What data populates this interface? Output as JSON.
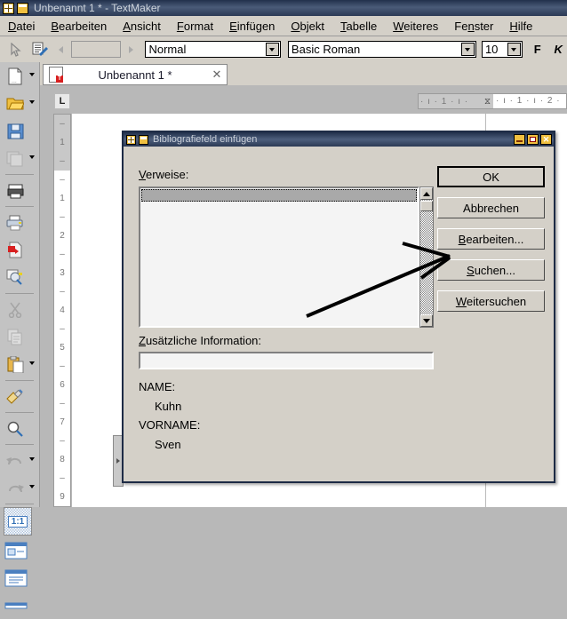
{
  "window": {
    "title": "Unbenannt 1 * - TextMaker",
    "icons": [
      "app-grid-icon",
      "document-icon"
    ]
  },
  "menubar": {
    "items": [
      {
        "label": "Datei",
        "accel": "D"
      },
      {
        "label": "Bearbeiten",
        "accel": "B"
      },
      {
        "label": "Ansicht",
        "accel": "A"
      },
      {
        "label": "Format",
        "accel": "F"
      },
      {
        "label": "Einfügen",
        "accel": "E"
      },
      {
        "label": "Objekt",
        "accel": "O"
      },
      {
        "label": "Tabelle",
        "accel": "T"
      },
      {
        "label": "Weiteres",
        "accel": "W"
      },
      {
        "label": "Fenster",
        "accel": "n"
      },
      {
        "label": "Hilfe",
        "accel": "H"
      }
    ]
  },
  "toolbar": {
    "page_field_value": "",
    "paragraph_style": "Normal",
    "font_name": "Basic Roman",
    "font_size": "10",
    "bold_label": "F",
    "italic_label": "K"
  },
  "tab": {
    "label": "Unbenannt 1 *",
    "close_label": "✕"
  },
  "rulers": {
    "tab_stop_marker": "L",
    "horizontal_ticks": "·  ı  ·  1  ·  ı  ·",
    "horizontal_ticks_page": "·  ı  ·  1  ·  ı  ·  2  ·",
    "vertical_labels": [
      "–",
      "1",
      "–",
      "–",
      "1",
      "–",
      "2",
      "–",
      "3",
      "–",
      "4",
      "–",
      "5",
      "–",
      "6",
      "–",
      "7",
      "–",
      "8",
      "–",
      "9"
    ]
  },
  "left_toolbar": {
    "items": [
      {
        "name": "new-document-icon",
        "dropdown": true
      },
      {
        "name": "open-folder-icon",
        "dropdown": true
      },
      {
        "name": "save-icon",
        "dropdown": false
      },
      {
        "name": "save-all-icon",
        "dropdown": true
      },
      {
        "name": "print-preview-icon",
        "dropdown": false
      },
      {
        "name": "print-icon",
        "dropdown": false
      },
      {
        "name": "export-pdf-icon",
        "dropdown": false
      },
      {
        "name": "send-email-icon",
        "dropdown": false
      },
      {
        "name": "cut-icon",
        "dropdown": false
      },
      {
        "name": "copy-icon",
        "dropdown": false
      },
      {
        "name": "paste-icon",
        "dropdown": true
      },
      {
        "name": "format-painter-icon",
        "dropdown": false
      },
      {
        "name": "zoom-icon",
        "dropdown": false
      },
      {
        "name": "undo-icon",
        "dropdown": true
      },
      {
        "name": "redo-icon",
        "dropdown": true
      },
      {
        "name": "zoom-100-icon",
        "label": "1:1",
        "dropdown": false
      },
      {
        "name": "view-layout-icon",
        "dropdown": false
      },
      {
        "name": "view-page-icon",
        "dropdown": false
      }
    ]
  },
  "dialog": {
    "title": "Bibliografiefeld einfügen",
    "titlebar_icons": [
      "app-grid-icon",
      "document-icon"
    ],
    "window_buttons": [
      "minimize-button",
      "maximize-button",
      "close-button"
    ],
    "references_label": "Verweise:",
    "references_label_accel": "V",
    "references_items": [
      ""
    ],
    "additional_info_label": "Zusätzliche Information:",
    "additional_info_accel": "Z",
    "additional_info_value": "",
    "fields": [
      {
        "key": "NAME:",
        "value": "Kuhn"
      },
      {
        "key": "VORNAME:",
        "value": "Sven"
      }
    ],
    "buttons": [
      {
        "label": "OK",
        "accel": "",
        "default": true
      },
      {
        "label": "Abbrechen",
        "accel": "",
        "default": false
      },
      {
        "label": "Bearbeiten...",
        "accel": "B",
        "default": false
      },
      {
        "label": "Suchen...",
        "accel": "S",
        "default": false
      },
      {
        "label": "Weitersuchen",
        "accel": "W",
        "default": false
      }
    ]
  },
  "annotation": {
    "type": "arrow",
    "description": "arrow pointing to Suchen... button",
    "color": "#000000"
  },
  "colors": {
    "titlebar_dark": "#21304b",
    "dialog_face": "#d4d0c8",
    "window_face": "#c3c3c3",
    "desktop": "#b8b8b8",
    "accent_yellow": "#f0c040"
  }
}
